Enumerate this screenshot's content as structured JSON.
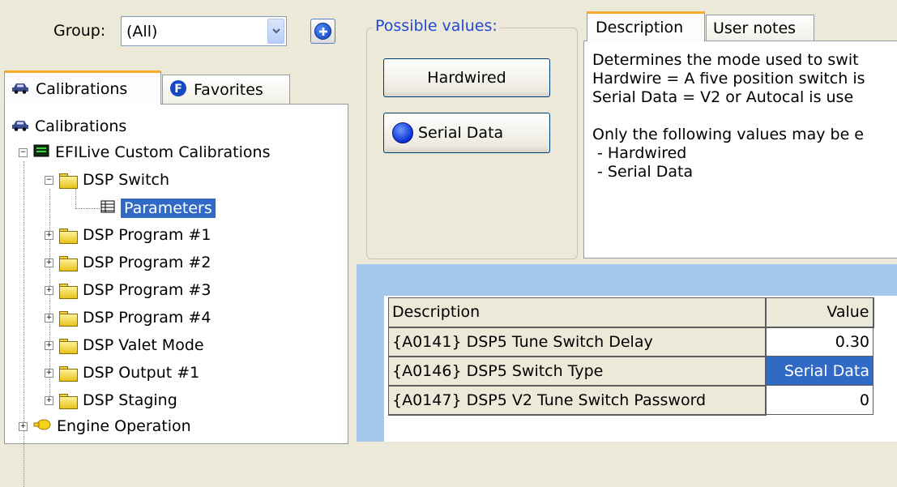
{
  "group": {
    "label": "Group:",
    "value": "(All)"
  },
  "left_tabs": {
    "calibrations": "Calibrations",
    "favorites": "Favorites"
  },
  "tree": {
    "root": "Calibrations",
    "efi": "EFILive Custom Calibrations",
    "dsp_switch": "DSP Switch",
    "parameters": "Parameters",
    "prog1": "DSP Program #1",
    "prog2": "DSP Program #2",
    "prog3": "DSP Program #3",
    "prog4": "DSP Program #4",
    "valet": "DSP Valet Mode",
    "output1": "DSP Output #1",
    "staging": "DSP Staging",
    "engine": "Engine Operation"
  },
  "possible_values": {
    "legend": "Possible values:",
    "hardwired": "Hardwired",
    "serial": "Serial Data"
  },
  "desc_tabs": {
    "description": "Description",
    "user_notes": "User notes"
  },
  "description_lines": [
    "Determines the mode used to swit",
    "Hardwire = A five position switch is",
    "Serial Data = V2 or Autocal is use",
    "",
    "Only the following values may be e",
    " - Hardwired",
    " - Serial Data"
  ],
  "grid": {
    "col_desc": "Description",
    "col_value": "Value",
    "rows": [
      {
        "desc": "{A0141} DSP5 Tune Switch Delay",
        "value": "0.30"
      },
      {
        "desc": "{A0146} DSP5 Switch Type",
        "value": "Serial Data"
      },
      {
        "desc": "{A0147} DSP5 V2 Tune Switch Password",
        "value": "0"
      }
    ]
  },
  "colors": {
    "selection": "#316ac5",
    "tab_accent": "#f7ab2d",
    "grid_area": "#a6c8ec",
    "legend": "#1f48d7"
  }
}
